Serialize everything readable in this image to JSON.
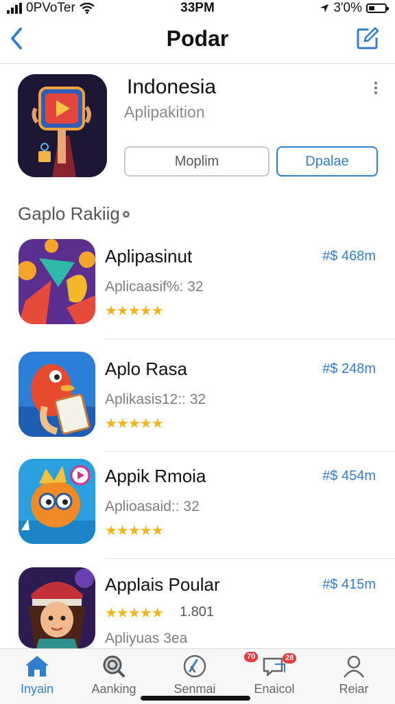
{
  "status": {
    "carrier": "0PVoTer",
    "time": "33PM",
    "battery": "3'0%"
  },
  "nav": {
    "title": "Podar"
  },
  "header_app": {
    "title": "Indonesia",
    "subtitle": "Aplipakition",
    "button_secondary": "Moplim",
    "button_primary": "Dpalae"
  },
  "section": {
    "title": "Gaplo Rakiig"
  },
  "apps": [
    {
      "name": "Aplipasinut",
      "subtitle": "Aplicaasif%: 32",
      "price": "#$ 468m",
      "stars": "★★★★★"
    },
    {
      "name": "Aplo Rasa",
      "subtitle": "Aplikasis12:: 32",
      "price": "#$ 248m",
      "stars": "★★★★★"
    },
    {
      "name": "Appik Rmoia",
      "subtitle": "Aplioasaid:: 32",
      "price": "#$ 454m",
      "stars": "★★★★★"
    },
    {
      "name": "Applais Poular",
      "subtitle": "Apliyuas 3ea",
      "price": "#$ 415m",
      "stars": "★★★★★",
      "rating": "1.801"
    }
  ],
  "tabs": [
    {
      "label": "Inyain",
      "icon": "home-icon"
    },
    {
      "label": "Aanking",
      "icon": "search-icon"
    },
    {
      "label": "Senmai",
      "icon": "compass-icon"
    },
    {
      "label": "Enaicol",
      "icon": "chat-icon",
      "badge_left": "70",
      "badge_right": "28"
    },
    {
      "label": "Reiar",
      "icon": "profile-icon"
    }
  ],
  "colors": {
    "accent": "#2f7fcf",
    "stars": "#f3b31b",
    "badge": "#e23c3c"
  }
}
